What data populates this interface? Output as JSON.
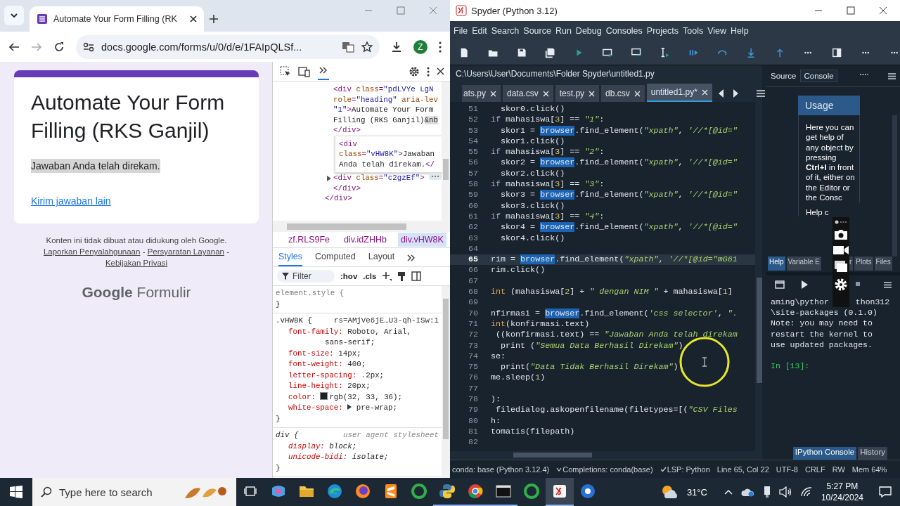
{
  "browser": {
    "tab": {
      "title": "Automate Your Form Filling (RK"
    },
    "address": "docs.google.com/forms/u/0/d/e/1FAIpQLSf...",
    "profile": "Z",
    "form": {
      "title": "Automate Your Form Filling (RKS Ganjil)",
      "message": "Jawaban Anda telah direkam.",
      "message_selected": true,
      "link": "Kirim jawaban lain",
      "disclaimer": "Konten ini tidak dibuat atau didukung oleh Google.",
      "footer_links": [
        "Laporkan Penyalahgunaan",
        "Persyaratan Layanan",
        "Kebijakan Privasi"
      ],
      "separator": "-",
      "logo": "**Google** Formulir"
    },
    "devtools": {
      "elements": {
        "nodes": [
          {
            "selected": false,
            "expandable": false,
            "lines": [
              [
                {
                  "text": "<div ",
                  "kind": "tag"
                },
                {
                  "text": "class",
                  "kind": "attr"
                },
                {
                  "text": "=",
                  "kind": "tag"
                },
                {
                  "text": "\"pdLVYe LgN",
                  "kind": "value"
                }
              ],
              [
                {
                  "text": "role",
                  "kind": "attr"
                },
                {
                  "text": "=",
                  "kind": "tag"
                },
                {
                  "text": "\"heading\" ",
                  "kind": "value"
                },
                {
                  "text": "aria-lev",
                  "kind": "attr"
                }
              ],
              [
                {
                  "text": "\"1\"",
                  "kind": "value"
                },
                {
                  "text": ">",
                  "kind": "tag"
                },
                {
                  "text": "Automate Your Form",
                  "kind": "text"
                }
              ],
              [
                {
                  "text": "Filling (RKS Ganjil)",
                  "kind": "text"
                },
                {
                  "text": "&nb",
                  "kind": "entity"
                }
              ],
              [
                {
                  "text": "</div>",
                  "kind": "tag"
                }
              ]
            ]
          },
          {
            "selected": true,
            "expandable": false,
            "lines": [
              [
                {
                  "text": "<div",
                  "kind": "tag"
                }
              ],
              [
                {
                  "text": "class",
                  "kind": "attr"
                },
                {
                  "text": "=",
                  "kind": "tag"
                },
                {
                  "text": "\"vHW8K\"",
                  "kind": "value"
                },
                {
                  "text": ">",
                  "kind": "tag"
                },
                {
                  "text": "Jawaban",
                  "kind": "text"
                }
              ],
              [
                {
                  "text": "Anda telah direkam.",
                  "kind": "text"
                },
                {
                  "text": "</",
                  "kind": "tag"
                }
              ]
            ]
          },
          {
            "selected": false,
            "expandable": true,
            "lines": [
              [
                {
                  "text": "<div ",
                  "kind": "tag"
                },
                {
                  "text": "class",
                  "kind": "attr"
                },
                {
                  "text": "=",
                  "kind": "tag"
                },
                {
                  "text": "\"c2gzEf\"",
                  "kind": "value"
                },
                {
                  "text": ">",
                  "kind": "tag"
                }
              ],
              [
                {
                  "text": "</div>",
                  "kind": "tag"
                }
              ]
            ]
          }
        ],
        "parent_close": "</div>"
      },
      "breadcrumbs": [
        {
          "label": "zf.RLS9Fe",
          "selected": false
        },
        {
          "label": "div.idZHHb",
          "selected": false
        },
        {
          "label": "div.vHW8K",
          "selected": true
        }
      ],
      "tabs": [
        {
          "label": "Styles",
          "selected": true
        },
        {
          "label": "Computed",
          "selected": false
        },
        {
          "label": "Layout",
          "selected": false
        }
      ],
      "filter": {
        "placeholder": "Filter"
      },
      "toggles": [
        ":hov",
        ".cls"
      ],
      "rules": [
        {
          "kind": "inline",
          "selector": "element.style {",
          "close": "}"
        },
        {
          "kind": "class",
          "selector": ".vHW8K {",
          "source": "rs=AMjVe6jE…U3-qh-ISw:1",
          "close": "}",
          "declarations": [
            {
              "kind": "plain",
              "property": "font-family:",
              "value": "Roboto, Arial,",
              "wrap": "sans-serif;"
            },
            {
              "kind": "plain",
              "property": "font-size:",
              "value": "14px;"
            },
            {
              "kind": "plain",
              "property": "font-weight:",
              "value": "400;"
            },
            {
              "kind": "plain",
              "property": "letter-spacing:",
              "value": ".2px;"
            },
            {
              "kind": "plain",
              "property": "line-height:",
              "value": "20px;"
            },
            {
              "kind": "color",
              "property": "color:",
              "value": "rgb(32, 33, 36);",
              "color": "#202124"
            },
            {
              "kind": "expandable",
              "property": "white-space:",
              "value": "pre-wrap;"
            }
          ]
        },
        {
          "kind": "useragent",
          "selector": "div {",
          "source": "user agent stylesheet",
          "close": "}",
          "declarations": [
            {
              "kind": "plain",
              "property": "display:",
              "value": "block;"
            },
            {
              "kind": "plain",
              "property": "unicode-bidi:",
              "value": "isolate;"
            }
          ]
        }
      ]
    }
  },
  "spyder": {
    "title": "Spyder (Python 3.12)",
    "menu": [
      "File",
      "Edit",
      "Search",
      "Source",
      "Run",
      "Debug",
      "Consoles",
      "Projects",
      "Tools",
      "View",
      "Help"
    ],
    "toolbar": [
      {
        "kind": "new"
      },
      {
        "kind": "open"
      },
      {
        "kind": "save"
      },
      {
        "kind": "saveall"
      },
      {
        "kind": "run"
      },
      {
        "kind": "runcell"
      },
      {
        "kind": "runcelladv"
      },
      {
        "kind": "runsel"
      },
      {
        "kind": "debug"
      },
      {
        "kind": "stepover"
      },
      {
        "kind": "stepinto"
      },
      {
        "kind": "stepreturn"
      },
      {
        "kind": "more"
      },
      {
        "kind": "pane"
      },
      {
        "kind": "more"
      },
      {
        "kind": "more"
      }
    ],
    "path": "C:\\Users\\User\\Documents\\Folder Spyder\\untitled1.py",
    "file_tabs": [
      {
        "label": "ats.py",
        "selected": false
      },
      {
        "label": "data.csv",
        "selected": false
      },
      {
        "label": "test.py",
        "selected": false
      },
      {
        "label": "db.csv",
        "selected": false
      },
      {
        "label": "untitled1.py*",
        "selected": true
      }
    ],
    "code": [
      {
        "number": "51",
        "current": false,
        "segments": [
          {
            "text": "  skor0.click()",
            "kind": "plain"
          }
        ]
      },
      {
        "number": "52",
        "current": false,
        "segments": [
          {
            "text": "if",
            "kind": "keyword"
          },
          {
            "text": " mahasiswa[",
            "kind": "plain"
          },
          {
            "text": "3",
            "kind": "number"
          },
          {
            "text": "] == ",
            "kind": "plain"
          },
          {
            "text": "\"1\"",
            "kind": "string"
          },
          {
            "text": ":",
            "kind": "plain"
          }
        ]
      },
      {
        "number": "53",
        "current": false,
        "segments": [
          {
            "text": "  skor1 = ",
            "kind": "plain"
          },
          {
            "text": "browser",
            "kind": "match"
          },
          {
            "text": ".find_element(",
            "kind": "plain"
          },
          {
            "text": "\"xpath\"",
            "kind": "string"
          },
          {
            "text": ", ",
            "kind": "plain"
          },
          {
            "text": "'//*[@id=\"",
            "kind": "string"
          }
        ]
      },
      {
        "number": "54",
        "current": false,
        "segments": [
          {
            "text": "  skor1.click()",
            "kind": "plain"
          }
        ]
      },
      {
        "number": "55",
        "current": false,
        "segments": [
          {
            "text": "if",
            "kind": "keyword"
          },
          {
            "text": " mahasiswa[",
            "kind": "plain"
          },
          {
            "text": "3",
            "kind": "number"
          },
          {
            "text": "] == ",
            "kind": "plain"
          },
          {
            "text": "\"2\"",
            "kind": "string"
          },
          {
            "text": ":",
            "kind": "plain"
          }
        ]
      },
      {
        "number": "56",
        "current": false,
        "segments": [
          {
            "text": "  skor2 = ",
            "kind": "plain"
          },
          {
            "text": "browser",
            "kind": "match"
          },
          {
            "text": ".find_element(",
            "kind": "plain"
          },
          {
            "text": "\"xpath\"",
            "kind": "string"
          },
          {
            "text": ", ",
            "kind": "plain"
          },
          {
            "text": "'//*[@id=\"",
            "kind": "string"
          }
        ]
      },
      {
        "number": "57",
        "current": false,
        "segments": [
          {
            "text": "  skor2.click()",
            "kind": "plain"
          }
        ]
      },
      {
        "number": "58",
        "current": false,
        "segments": [
          {
            "text": "if",
            "kind": "keyword"
          },
          {
            "text": " mahasiswa[",
            "kind": "plain"
          },
          {
            "text": "3",
            "kind": "number"
          },
          {
            "text": "] == ",
            "kind": "plain"
          },
          {
            "text": "\"3\"",
            "kind": "string"
          },
          {
            "text": ":",
            "kind": "plain"
          }
        ]
      },
      {
        "number": "59",
        "current": false,
        "segments": [
          {
            "text": "  skor3 = ",
            "kind": "plain"
          },
          {
            "text": "browser",
            "kind": "match"
          },
          {
            "text": ".find_element(",
            "kind": "plain"
          },
          {
            "text": "\"xpath\"",
            "kind": "string"
          },
          {
            "text": ", ",
            "kind": "plain"
          },
          {
            "text": "'//*[@id=\"",
            "kind": "string"
          }
        ]
      },
      {
        "number": "60",
        "current": false,
        "segments": [
          {
            "text": "  skor3.click()",
            "kind": "plain"
          }
        ]
      },
      {
        "number": "61",
        "current": false,
        "segments": [
          {
            "text": "if",
            "kind": "keyword"
          },
          {
            "text": " mahasiswa[",
            "kind": "plain"
          },
          {
            "text": "3",
            "kind": "number"
          },
          {
            "text": "] == ",
            "kind": "plain"
          },
          {
            "text": "\"4\"",
            "kind": "string"
          },
          {
            "text": ":",
            "kind": "plain"
          }
        ]
      },
      {
        "number": "62",
        "current": false,
        "segments": [
          {
            "text": "  skor4 = ",
            "kind": "plain"
          },
          {
            "text": "browser",
            "kind": "match"
          },
          {
            "text": ".find_element(",
            "kind": "plain"
          },
          {
            "text": "\"xpath\"",
            "kind": "string"
          },
          {
            "text": ", ",
            "kind": "plain"
          },
          {
            "text": "'//*[@id=\"",
            "kind": "string"
          }
        ]
      },
      {
        "number": "63",
        "current": false,
        "segments": [
          {
            "text": "  skor4.click()",
            "kind": "plain"
          }
        ]
      },
      {
        "number": "64",
        "current": false
      },
      {
        "number": "65",
        "current": true,
        "segments": [
          {
            "text": "rim = ",
            "kind": "plain"
          },
          {
            "text": "browser",
            "kind": "match"
          },
          {
            "text": ".find_element(",
            "kind": "plain"
          },
          {
            "text": "\"xpath\"",
            "kind": "string"
          },
          {
            "text": ", ",
            "kind": "plain"
          },
          {
            "text": "'//*[@id=\"mG61",
            "kind": "string"
          }
        ]
      },
      {
        "number": "66",
        "current": false,
        "segments": [
          {
            "text": "rim.click()",
            "kind": "plain"
          }
        ]
      },
      {
        "number": "67",
        "current": false
      },
      {
        "number": "68",
        "current": false,
        "segments": [
          {
            "text": "int",
            "kind": "builtin"
          },
          {
            "text": " (mahasiswa[",
            "kind": "plain"
          },
          {
            "text": "2",
            "kind": "number"
          },
          {
            "text": "] + ",
            "kind": "plain"
          },
          {
            "text": "\" dengan NIM \"",
            "kind": "string"
          },
          {
            "text": " + mahasiswa[",
            "kind": "plain"
          },
          {
            "text": "1",
            "kind": "number"
          },
          {
            "text": "]",
            "kind": "plain"
          }
        ]
      },
      {
        "number": "69",
        "current": false
      },
      {
        "number": "70",
        "current": false,
        "segments": [
          {
            "text": "nfirmasi = ",
            "kind": "plain"
          },
          {
            "text": "browser",
            "kind": "match"
          },
          {
            "text": ".find_element(",
            "kind": "plain"
          },
          {
            "text": "'css selector'",
            "kind": "string"
          },
          {
            "text": ", ",
            "kind": "plain"
          },
          {
            "text": "\".",
            "kind": "string"
          }
        ]
      },
      {
        "number": "71",
        "current": false,
        "segments": [
          {
            "text": "int",
            "kind": "builtin"
          },
          {
            "text": "(konfirmasi.text)",
            "kind": "plain"
          }
        ]
      },
      {
        "number": "72",
        "current": false,
        "segments": [
          {
            "text": " ((konfirmasi.text) == ",
            "kind": "plain"
          },
          {
            "text": "\"Jawaban Anda telah direkam",
            "kind": "string"
          }
        ]
      },
      {
        "number": "73",
        "current": false,
        "segments": [
          {
            "text": "  print (",
            "kind": "plain"
          },
          {
            "text": "\"Semua Data Berhasil Direkam\"",
            "kind": "string"
          },
          {
            "text": ")",
            "kind": "plain"
          }
        ]
      },
      {
        "number": "74",
        "current": false,
        "segments": [
          {
            "text": "se:",
            "kind": "plain"
          }
        ]
      },
      {
        "number": "75",
        "current": false,
        "segments": [
          {
            "text": "  print(",
            "kind": "plain"
          },
          {
            "text": "\"Data Tidak Berhasil Direkam\"",
            "kind": "string"
          },
          {
            "text": ")",
            "kind": "plain"
          }
        ]
      },
      {
        "number": "76",
        "current": false,
        "segments": [
          {
            "text": "me.sleep(",
            "kind": "plain"
          },
          {
            "text": "1",
            "kind": "number"
          },
          {
            "text": ")",
            "kind": "plain"
          }
        ]
      },
      {
        "number": "77",
        "current": false
      },
      {
        "number": "78",
        "current": false,
        "segments": [
          {
            "text": "):",
            "kind": "plain"
          }
        ]
      },
      {
        "number": "79",
        "current": false,
        "segments": [
          {
            "text": " filedialog.askopenfilename(filetypes=[(",
            "kind": "plain"
          },
          {
            "text": "\"CSV Files",
            "kind": "string"
          }
        ]
      },
      {
        "number": "80",
        "current": false,
        "segments": [
          {
            "text": "h:",
            "kind": "plain"
          }
        ]
      },
      {
        "number": "81",
        "current": false,
        "segments": [
          {
            "text": "tomatis(filepath)",
            "kind": "plain"
          }
        ]
      },
      {
        "number": "82",
        "current": false
      }
    ],
    "help": {
      "source_label": "Source",
      "source_value": "Console",
      "heading": "Usage",
      "text": "Here you can get help of any object by pressing **Ctrl+I** in front of it, either on the Editor or the Consc",
      "text_2": "Help c",
      "tabs": [
        {
          "label": "Help",
          "selected": true
        },
        {
          "label": "Variable E",
          "selected": false
        },
        {
          "label": "r",
          "selected": false
        },
        {
          "label": "Plots",
          "selected": false
        },
        {
          "label": "Files",
          "selected": false
        }
      ]
    },
    "console": {
      "lines": [
        {
          "parts": [
            "aming\\pythor",
            "thon312"
          ],
          "kind": "output"
        },
        {
          "parts": [
            "\\site-packages (0.1.0)"
          ],
          "kind": "output"
        },
        {
          "parts": [
            "Note: you may need to"
          ],
          "kind": "output"
        },
        {
          "parts": [
            "restart the kernel to"
          ],
          "kind": "output"
        },
        {
          "parts": [
            "use updated packages."
          ],
          "kind": "output"
        },
        {
          "parts": [
            "In [13]:"
          ],
          "kind": "prompt"
        }
      ],
      "tabs": [
        {
          "label": "IPython Console",
          "selected": true
        },
        {
          "label": "History",
          "selected": false
        }
      ]
    },
    "status": [
      "conda: base (Python 3.12.4)",
      "Completions: conda(base)",
      "LSP: Python",
      "Line 65, Col 22",
      "UTF-8",
      "CRLF",
      "RW",
      "Mem 64%"
    ]
  },
  "taskbar": {
    "search": {
      "placeholder": "Type here to search"
    },
    "apps": [
      {
        "kind": "copilot",
        "running": false,
        "selected": false
      },
      {
        "kind": "explorer",
        "running": false,
        "selected": false
      },
      {
        "kind": "edge",
        "running": false,
        "selected": false
      },
      {
        "kind": "firefox",
        "running": false,
        "selected": false
      },
      {
        "kind": "sublime",
        "running": false,
        "selected": false
      },
      {
        "kind": "loader",
        "running": false,
        "selected": false
      },
      {
        "kind": "python",
        "running": true,
        "selected": false
      },
      {
        "kind": "chrome",
        "running": true,
        "selected": false
      },
      {
        "kind": "terminal",
        "running": true,
        "selected": false
      },
      {
        "kind": "loader",
        "running": false,
        "selected": false
      },
      {
        "kind": "spyder",
        "running": true,
        "selected": true
      },
      {
        "kind": "blueapp",
        "running": false,
        "selected": false
      }
    ],
    "temperature": "31°C",
    "time": "5:27 PM",
    "date": "10/24/2024"
  }
}
